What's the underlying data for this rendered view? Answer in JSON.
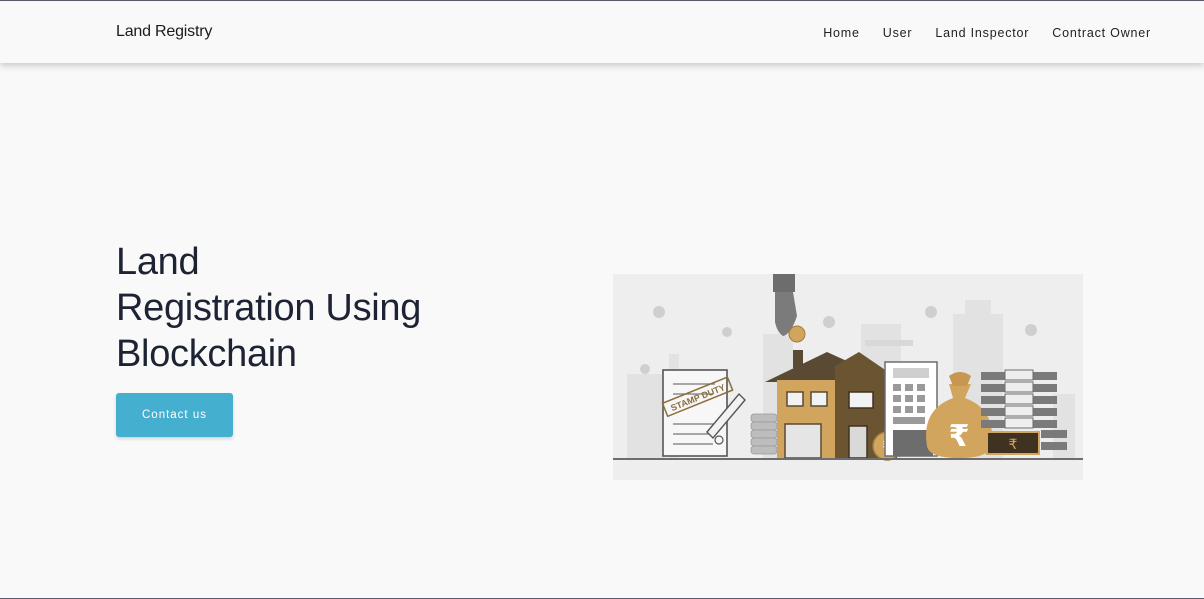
{
  "navbar": {
    "brand": "Land Registry",
    "links": [
      "Home",
      "User",
      "Land Inspector",
      "Contract Owner"
    ]
  },
  "hero": {
    "title_lines": [
      "Land",
      "Registration Using",
      "Blockchain"
    ],
    "cta_label": "Contact us"
  },
  "illustration": {
    "stamp_text": "STAMP DUTY",
    "currency_symbol": "₹"
  },
  "colors": {
    "background": "#f9f9fa",
    "accent": "#45afd0",
    "heading": "#1d2333",
    "gold": "#d2a55e",
    "dark_brown": "#6a5432",
    "gray": "#6d6d6d"
  }
}
